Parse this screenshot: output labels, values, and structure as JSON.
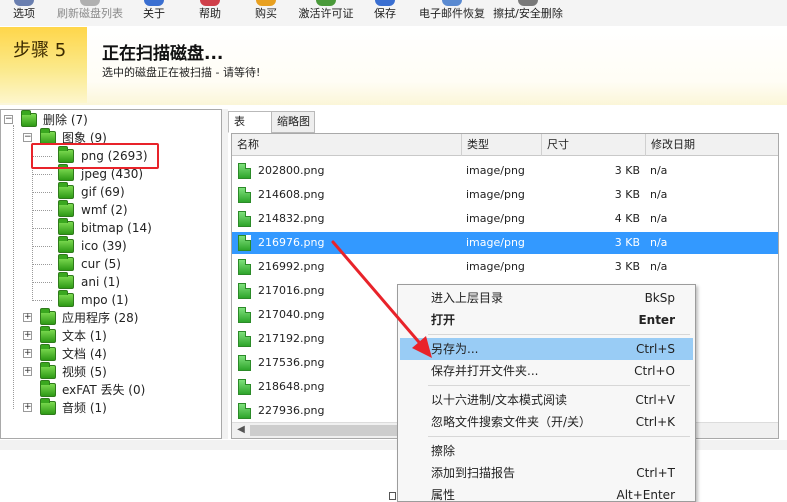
{
  "colors": {
    "accent_selected": "#3399ff",
    "annotation_red": "#e8232a",
    "menu_hover": "#99ccf5",
    "folder_green": "#2e9a16"
  },
  "toolbar": {
    "items": [
      {
        "label": "选项",
        "icon": "options-icon",
        "disabled": false,
        "color": "#6a7fb0"
      },
      {
        "label": "刷新磁盘列表",
        "icon": "refresh-drives-icon",
        "disabled": true,
        "color": "#b0b0b0"
      },
      {
        "label": "关于",
        "icon": "about-icon",
        "disabled": false,
        "color": "#3a6fd1"
      },
      {
        "label": "帮助",
        "icon": "help-icon",
        "disabled": false,
        "color": "#d0404a"
      },
      {
        "label": "购买",
        "icon": "buy-icon",
        "disabled": false,
        "color": "#e8a020"
      },
      {
        "label": "激活许可证",
        "icon": "activate-license-icon",
        "disabled": false,
        "color": "#4a9a3a"
      },
      {
        "label": "保存",
        "icon": "save-icon",
        "disabled": false,
        "color": "#3a6fd1"
      },
      {
        "label": "电子邮件恢复",
        "icon": "email-recovery-icon",
        "disabled": false,
        "color": "#5a8ad1"
      },
      {
        "label": "擦拭/安全删除",
        "icon": "secure-delete-icon",
        "disabled": false,
        "color": "#7a7a7a"
      }
    ]
  },
  "banner": {
    "step": "步骤 5",
    "title": "正在扫描磁盘...",
    "subtitle": "选中的磁盘正在被扫描 - 请等待!"
  },
  "tree": {
    "root": {
      "label": "删除 (7)",
      "expander": "−"
    },
    "images": {
      "label": "图象 (9)",
      "expander": "−"
    },
    "image_children": [
      "png (2693)",
      "jpeg (430)",
      "gif (69)",
      "wmf (2)",
      "bitmap (14)",
      "ico (39)",
      "cur (5)",
      "ani (1)",
      "mpo (1)"
    ],
    "others": [
      {
        "label": "应用程序 (28)",
        "expander": "+"
      },
      {
        "label": "文本 (1)",
        "expander": "+"
      },
      {
        "label": "文档 (4)",
        "expander": "+"
      },
      {
        "label": "视频 (5)",
        "expander": "+"
      },
      {
        "label": "exFAT 丢失 (0)",
        "expander": ""
      },
      {
        "label": "音频 (1)",
        "expander": "+"
      }
    ]
  },
  "tabs": [
    "表",
    "缩略图"
  ],
  "list": {
    "columns": [
      "名称",
      "类型",
      "尺寸",
      "修改日期"
    ],
    "rows": [
      {
        "name": "202800.png",
        "type": "image/png",
        "size": "3 KB",
        "date": "n/a",
        "selected": false
      },
      {
        "name": "214608.png",
        "type": "image/png",
        "size": "3 KB",
        "date": "n/a",
        "selected": false
      },
      {
        "name": "214832.png",
        "type": "image/png",
        "size": "4 KB",
        "date": "n/a",
        "selected": false
      },
      {
        "name": "216976.png",
        "type": "image/png",
        "size": "3 KB",
        "date": "n/a",
        "selected": true
      },
      {
        "name": "216992.png",
        "type": "image/png",
        "size": "3 KB",
        "date": "n/a",
        "selected": false
      },
      {
        "name": "217016.png",
        "type": "",
        "size": "",
        "date": "",
        "selected": false
      },
      {
        "name": "217040.png",
        "type": "",
        "size": "",
        "date": "",
        "selected": false
      },
      {
        "name": "217192.png",
        "type": "",
        "size": "",
        "date": "",
        "selected": false
      },
      {
        "name": "217536.png",
        "type": "",
        "size": "",
        "date": "",
        "selected": false
      },
      {
        "name": "218648.png",
        "type": "",
        "size": "",
        "date": "",
        "selected": false
      },
      {
        "name": "227936.png",
        "type": "",
        "size": "",
        "date": "",
        "selected": false
      }
    ]
  },
  "context_menu": {
    "items": [
      {
        "label": "进入上层目录",
        "shortcut": "BkSp"
      },
      {
        "label": "打开",
        "shortcut": "Enter",
        "bold": true
      },
      {
        "label": "另存为...",
        "shortcut": "Ctrl+S",
        "hover": true
      },
      {
        "label": "保存并打开文件夹...",
        "shortcut": "Ctrl+O"
      },
      {
        "label": "以十六进制/文本模式阅读",
        "shortcut": "Ctrl+V"
      },
      {
        "label": "忽略文件搜索文件夹（开/关）",
        "shortcut": "Ctrl+K"
      },
      {
        "label": "擦除",
        "shortcut": ""
      },
      {
        "label": "添加到扫描报告",
        "shortcut": "Ctrl+T"
      },
      {
        "label": "属性",
        "shortcut": "Alt+Enter"
      }
    ]
  }
}
